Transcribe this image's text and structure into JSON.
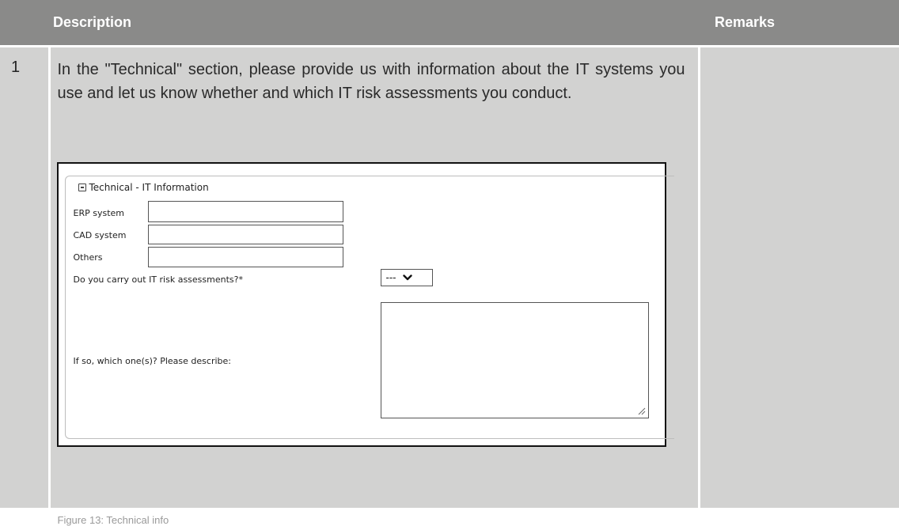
{
  "table": {
    "header": {
      "num": "",
      "description": "Description",
      "remarks": "Remarks"
    },
    "row": {
      "num": "1",
      "description": "In the \"Technical\" section, please provide us with information about the IT systems you use and let us know whether and which IT risk assessments you conduct.",
      "remarks": ""
    }
  },
  "figure": {
    "legend": "Technical - IT Information",
    "fields": {
      "erp_label": "ERP system",
      "erp_value": "",
      "cad_label": "CAD system",
      "cad_value": "",
      "others_label": "Others",
      "others_value": "",
      "risk_label": "Do you carry out IT risk assessments?*",
      "risk_selected": "---",
      "describe_label": "If so, which one(s)? Please describe:",
      "describe_value": ""
    },
    "caption": "Figure 13: Technical info"
  },
  "colors": {
    "header_bg": "#8a8a89",
    "cell_bg": "#d2d2d1",
    "caption": "#9a9a9a"
  }
}
